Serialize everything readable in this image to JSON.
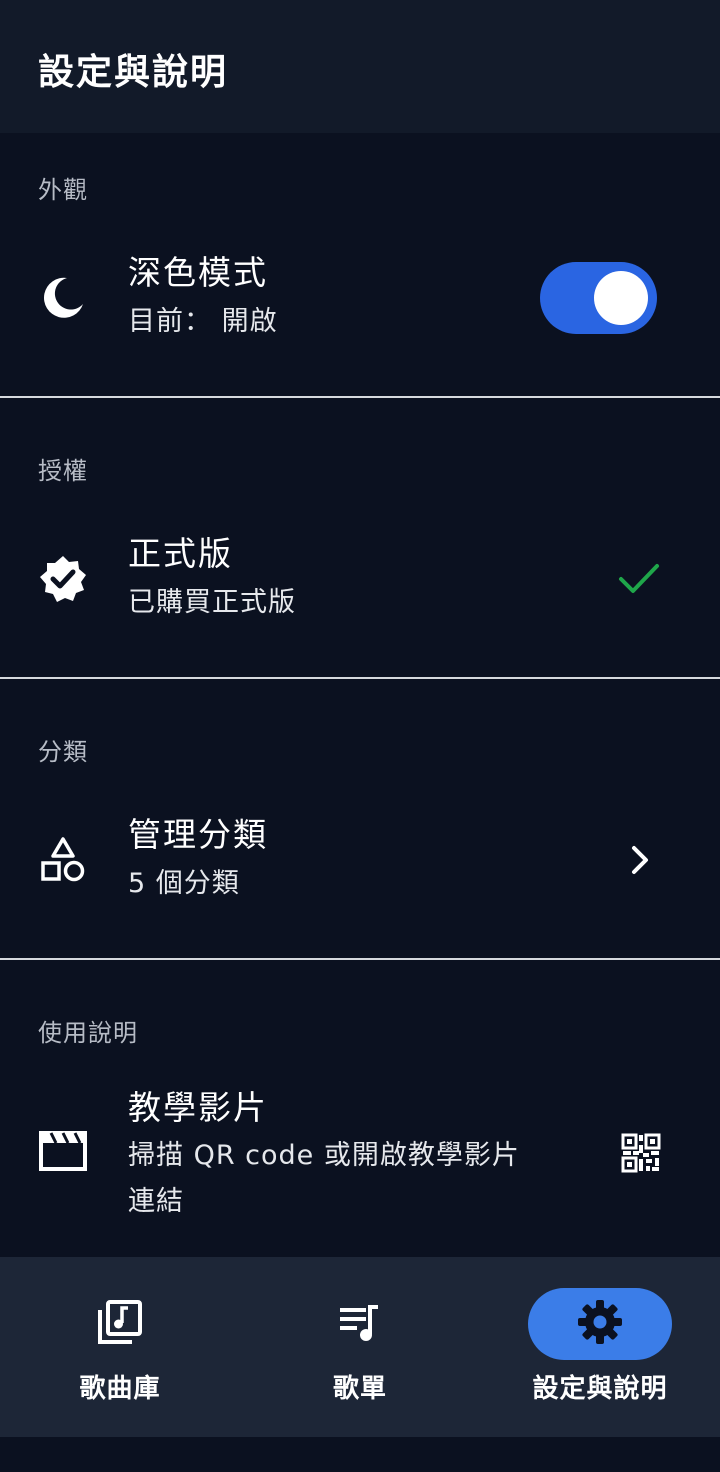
{
  "header": {
    "title": "設定與說明"
  },
  "sections": {
    "appearance": {
      "header": "外觀",
      "dark_mode": {
        "title": "深色模式",
        "subtitle": "目前： 開啟",
        "enabled": true,
        "icon": "moon-icon"
      }
    },
    "license": {
      "header": "授權",
      "pro": {
        "title": "正式版",
        "subtitle": "已購買正式版",
        "icon": "verified-badge-icon",
        "status_icon": "checkmark-icon",
        "status_color": "#1fa64a"
      }
    },
    "categories": {
      "header": "分類",
      "manage": {
        "title": "管理分類",
        "subtitle": "5 個分類",
        "icon": "shapes-icon",
        "trailing_icon": "chevron-right-icon"
      }
    },
    "help": {
      "header": "使用說明",
      "tutorial": {
        "title": "教學影片",
        "subtitle_line1": "掃描 QR code 或開啟教學影片",
        "subtitle_line2": "連結",
        "icon": "clapperboard-icon",
        "trailing_icon": "qr-code-icon"
      }
    }
  },
  "bottom_nav": {
    "items": [
      {
        "label": "歌曲庫",
        "icon": "music-library-icon",
        "active": false
      },
      {
        "label": "歌單",
        "icon": "playlist-icon",
        "active": false
      },
      {
        "label": "設定與說明",
        "icon": "gear-icon",
        "active": true
      }
    ]
  },
  "colors": {
    "background": "#0b1120",
    "topbar": "#121a29",
    "accent": "#2a65e2",
    "nav_active": "#3b7de8",
    "check": "#1fa64a"
  }
}
